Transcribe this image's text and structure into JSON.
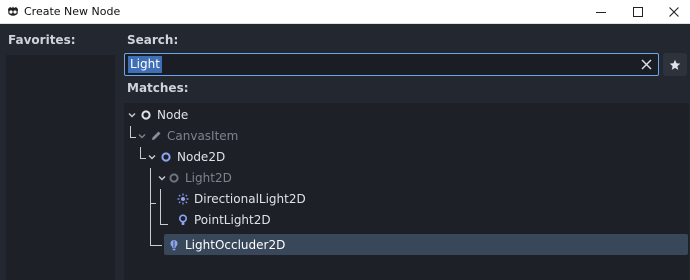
{
  "window": {
    "title": "Create New Node"
  },
  "favorites": {
    "label": "Favorites:"
  },
  "search": {
    "label": "Search:",
    "value": "Light"
  },
  "matches": {
    "label": "Matches:",
    "items": [
      {
        "label": "Node",
        "icon": "circle-node-icon",
        "expandable": true,
        "dimmed": false,
        "selected": false
      },
      {
        "label": "CanvasItem",
        "icon": "pencil-icon",
        "expandable": true,
        "dimmed": true,
        "selected": false
      },
      {
        "label": "Node2D",
        "icon": "circle-node2d-icon",
        "expandable": true,
        "dimmed": false,
        "selected": false
      },
      {
        "label": "Light2D",
        "icon": "circle-light2d-icon",
        "expandable": true,
        "dimmed": true,
        "selected": false
      },
      {
        "label": "DirectionalLight2D",
        "icon": "sun-icon",
        "expandable": false,
        "dimmed": false,
        "selected": false
      },
      {
        "label": "PointLight2D",
        "icon": "point-light-icon",
        "expandable": false,
        "dimmed": false,
        "selected": false
      },
      {
        "label": "LightOccluder2D",
        "icon": "light-occluder-icon",
        "expandable": false,
        "dimmed": false,
        "selected": true
      }
    ]
  },
  "colors": {
    "accent": "#6aa6f0",
    "selection": "#39475a",
    "node_2d": "#8da5f3",
    "dimmed_text": "#7d838d",
    "text": "#e0e4ea"
  }
}
